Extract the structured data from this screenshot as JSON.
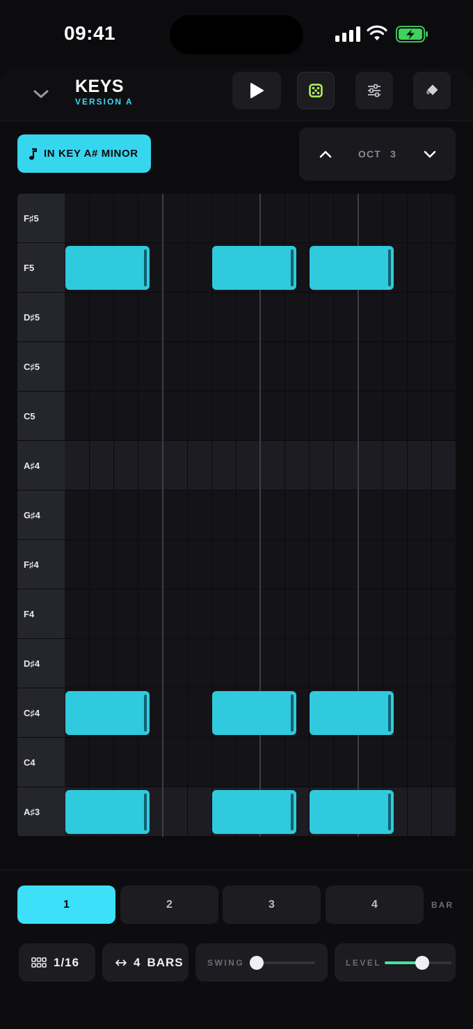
{
  "status": {
    "time": "09:41"
  },
  "header": {
    "title": "KEYS",
    "subtitle": "VERSION A"
  },
  "key_button": {
    "label": "IN KEY A# MINOR"
  },
  "octave": {
    "label": "OCT",
    "value": "3"
  },
  "colors": {
    "accent": "#36d6ef",
    "note": "#30cade",
    "level": "#43e6a0",
    "dice": "#b4f35a"
  },
  "icons": {
    "collapse": "chevron-down-icon",
    "play": "play-icon",
    "dice": "dice-icon",
    "settings": "sliders-icon",
    "erase": "eraser-icon",
    "key": "music-note-icon",
    "oct_up": "chevron-up-icon",
    "oct_down": "chevron-down-icon",
    "grid": "grid-icon",
    "length": "arrows-horizontal-icon"
  },
  "rows": [
    {
      "label": "F♯5",
      "black": false
    },
    {
      "label": "F5",
      "black": false
    },
    {
      "label": "D♯5",
      "black": false
    },
    {
      "label": "C♯5",
      "black": false
    },
    {
      "label": "C5",
      "black": false
    },
    {
      "label": "A♯4",
      "black": true
    },
    {
      "label": "G♯4",
      "black": false
    },
    {
      "label": "F♯4",
      "black": false
    },
    {
      "label": "F4",
      "black": false
    },
    {
      "label": "D♯4",
      "black": false
    },
    {
      "label": "C♯4",
      "black": false
    },
    {
      "label": "C4",
      "black": false
    },
    {
      "label": "A♯3",
      "black": true
    }
  ],
  "grid": {
    "steps": 16,
    "beats_per_bar": 4
  },
  "notes": [
    {
      "row": "F5",
      "start": 0,
      "length": 3.5
    },
    {
      "row": "F5",
      "start": 6,
      "length": 3.5
    },
    {
      "row": "F5",
      "start": 10,
      "length": 3.5
    },
    {
      "row": "C♯4",
      "start": 0,
      "length": 3.5
    },
    {
      "row": "C♯4",
      "start": 6,
      "length": 3.5
    },
    {
      "row": "C♯4",
      "start": 10,
      "length": 3.5
    },
    {
      "row": "A♯3",
      "start": 0,
      "length": 3.5
    },
    {
      "row": "A♯3",
      "start": 6,
      "length": 3.5
    },
    {
      "row": "A♯3",
      "start": 10,
      "length": 3.5
    }
  ],
  "bars": {
    "tabs": [
      "1",
      "2",
      "3",
      "4"
    ],
    "active": 0,
    "label": "BAR"
  },
  "controls": {
    "grid_value": "1/16",
    "length_value": "4",
    "length_unit": "BARS",
    "swing_label": "SWING",
    "swing_value": 0,
    "level_label": "LEVEL",
    "level_value": 0.56
  }
}
